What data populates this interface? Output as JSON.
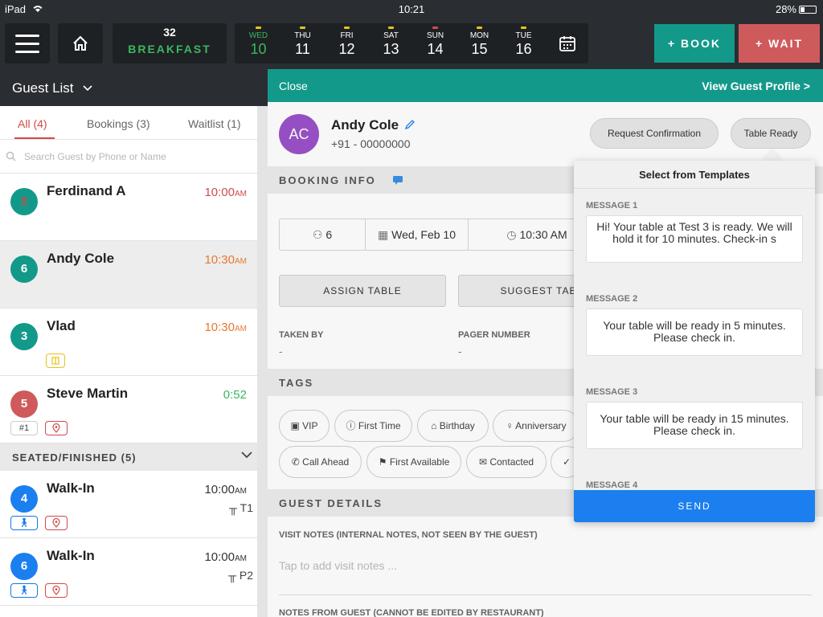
{
  "status_bar": {
    "device": "iPad",
    "time": "10:21",
    "battery": "28%"
  },
  "topbar": {
    "meal_count": "32",
    "meal_name": "BREAKFAST",
    "days": [
      {
        "name": "WED",
        "num": "10",
        "active": true
      },
      {
        "name": "THU",
        "num": "11"
      },
      {
        "name": "FRI",
        "num": "12"
      },
      {
        "name": "SAT",
        "num": "13"
      },
      {
        "name": "SUN",
        "num": "14"
      },
      {
        "name": "MON",
        "num": "15"
      },
      {
        "name": "TUE",
        "num": "16"
      }
    ],
    "book_label": "+ BOOK",
    "wait_label": "+ WAIT"
  },
  "left": {
    "title": "Guest List",
    "tabs": {
      "all": "All (4)",
      "bookings": "Bookings (3)",
      "waitlist": "Waitlist (1)"
    },
    "search_placeholder": "Search Guest by Phone or Name",
    "guests": [
      {
        "count": "2",
        "name": "Ferdinand A",
        "time": "10:00",
        "ampm": "AM"
      },
      {
        "count": "6",
        "name": "Andy Cole",
        "time": "10:30",
        "ampm": "AM"
      },
      {
        "count": "3",
        "name": "Vlad",
        "time": "10:30",
        "ampm": "AM"
      },
      {
        "count": "5",
        "name": "Steve Martin",
        "time": "0:52",
        "chip": "#1"
      }
    ],
    "seated_header": "SEATED/FINISHED (5)",
    "seated": [
      {
        "count": "4",
        "name": "Walk-In",
        "time": "10:00",
        "ampm": "AM",
        "table": "T1"
      },
      {
        "count": "6",
        "name": "Walk-In",
        "time": "10:00",
        "ampm": "AM",
        "table": "P2"
      }
    ]
  },
  "detail": {
    "close": "Close",
    "view_profile": "View Guest Profile >",
    "initials": "AC",
    "name": "Andy Cole",
    "phone": "+91 - 00000000",
    "request_confirmation": "Request Confirmation",
    "table_ready": "Table Ready",
    "booking_info": "BOOKING INFO",
    "party_size": "6",
    "date": "Wed, Feb 10",
    "time": "10:30 AM",
    "assign_table": "ASSIGN TABLE",
    "suggest_table": "SUGGEST TAB",
    "taken_by_label": "TAKEN BY",
    "taken_by_value": "-",
    "pager_label": "PAGER NUMBER",
    "pager_value": "-",
    "tags_label": "TAGS",
    "tags_row1": [
      "VIP",
      "First Time",
      "Birthday",
      "Anniversary"
    ],
    "tags_row2": [
      "Call Ahead",
      "First Available",
      "Contacted"
    ],
    "guest_details": "GUEST DETAILS",
    "visit_notes_label": "VISIT NOTES (INTERNAL NOTES, NOT SEEN BY THE GUEST)",
    "visit_notes_placeholder": "Tap to add visit notes ...",
    "notes_from_guest_label": "NOTES FROM GUEST (CANNOT BE EDITED BY RESTAURANT)"
  },
  "templates": {
    "title": "Select from Templates",
    "messages": [
      {
        "label": "MESSAGE 1",
        "text": "Hi! Your table at Test 3 is ready. We will hold it for 10 minutes. Check-in s"
      },
      {
        "label": "MESSAGE 2",
        "text": "Your table will be ready in 5 minutes. Please check in."
      },
      {
        "label": "MESSAGE 3",
        "text": "Your table will be ready in 15 minutes. Please check in."
      },
      {
        "label": "MESSAGE 4",
        "text": ""
      }
    ],
    "send": "SEND"
  },
  "colors": {
    "teal": "#13998a",
    "coral": "#cf5a5c",
    "green": "#3bb75e",
    "red": "#d24a4a",
    "orange": "#e8792e",
    "blue": "#1b7ff0",
    "purple": "#9b52c9"
  }
}
